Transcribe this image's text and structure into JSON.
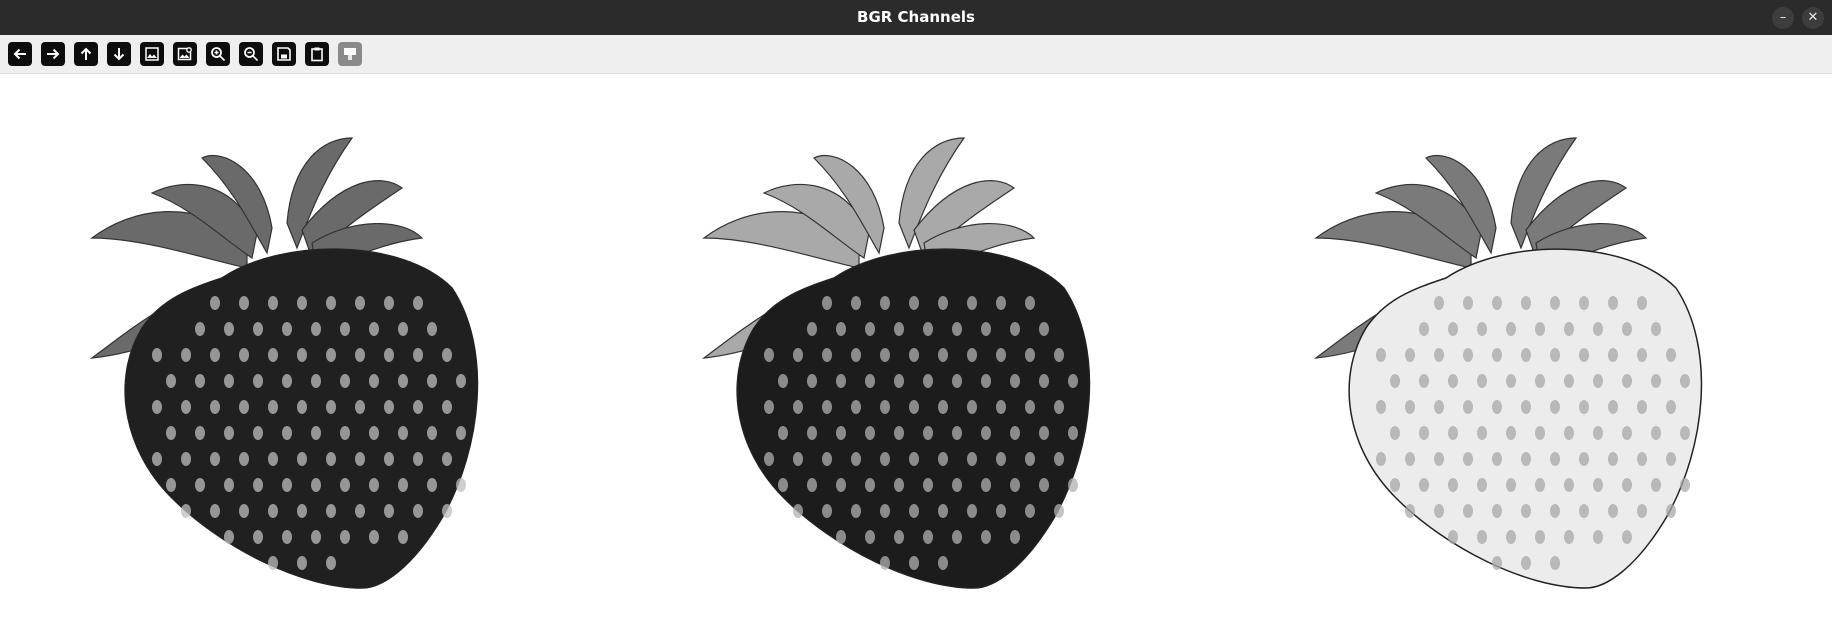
{
  "window": {
    "title": "BGR Channels",
    "minimize_symbol": "–",
    "close_symbol": "✕"
  },
  "toolbar": {
    "buttons": [
      {
        "icon": "arrow-left-icon",
        "enabled": true
      },
      {
        "icon": "arrow-right-icon",
        "enabled": true
      },
      {
        "icon": "arrow-up-icon",
        "enabled": true
      },
      {
        "icon": "arrow-down-icon",
        "enabled": true
      },
      {
        "icon": "image-icon",
        "enabled": true
      },
      {
        "icon": "image-search-icon",
        "enabled": true
      },
      {
        "icon": "zoom-in-icon",
        "enabled": true
      },
      {
        "icon": "zoom-out-icon",
        "enabled": true
      },
      {
        "icon": "save-icon",
        "enabled": true
      },
      {
        "icon": "clipboard-icon",
        "enabled": true
      },
      {
        "icon": "properties-icon",
        "enabled": false
      }
    ]
  },
  "channels": [
    {
      "channel": "blue",
      "body_color": "#202020",
      "seed_color": "#bdbdbd",
      "leaf_color": "#6a6a6a"
    },
    {
      "channel": "green",
      "body_color": "#1c1c1c",
      "seed_color": "#b0b0b0",
      "leaf_color": "#a9a9a9"
    },
    {
      "channel": "red",
      "body_color": "#ececec",
      "seed_color": "#a8a8a8",
      "leaf_color": "#7a7a7a"
    }
  ]
}
